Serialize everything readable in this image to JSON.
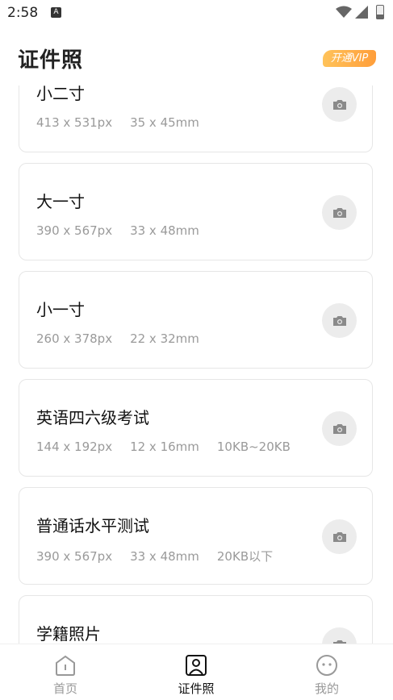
{
  "status_bar": {
    "time": "2:58",
    "notification_icon": "A"
  },
  "header": {
    "title": "证件照",
    "vip_label": "开通VIP"
  },
  "cards": [
    {
      "title": "小二寸",
      "specs": [
        "413 x 531px",
        "35 x 45mm"
      ]
    },
    {
      "title": "大一寸",
      "specs": [
        "390 x 567px",
        "33 x 48mm"
      ]
    },
    {
      "title": "小一寸",
      "specs": [
        "260 x 378px",
        "22 x 32mm"
      ]
    },
    {
      "title": "英语四六级考试",
      "specs": [
        "144 x 192px",
        "12 x 16mm",
        "10KB~20KB"
      ]
    },
    {
      "title": "普通话水平测试",
      "specs": [
        "390 x 567px",
        "33 x 48mm",
        "20KB以下"
      ]
    },
    {
      "title": "学籍照片",
      "specs": []
    }
  ],
  "tabs": [
    {
      "label": "首页",
      "icon": "home-icon"
    },
    {
      "label": "证件照",
      "icon": "id-photo-icon"
    },
    {
      "label": "我的",
      "icon": "profile-icon"
    }
  ],
  "colors": {
    "vip_start": "#ffc35a",
    "vip_end": "#ff9e3a",
    "muted": "#9a9a9a",
    "card_border": "#e6e6e6"
  }
}
